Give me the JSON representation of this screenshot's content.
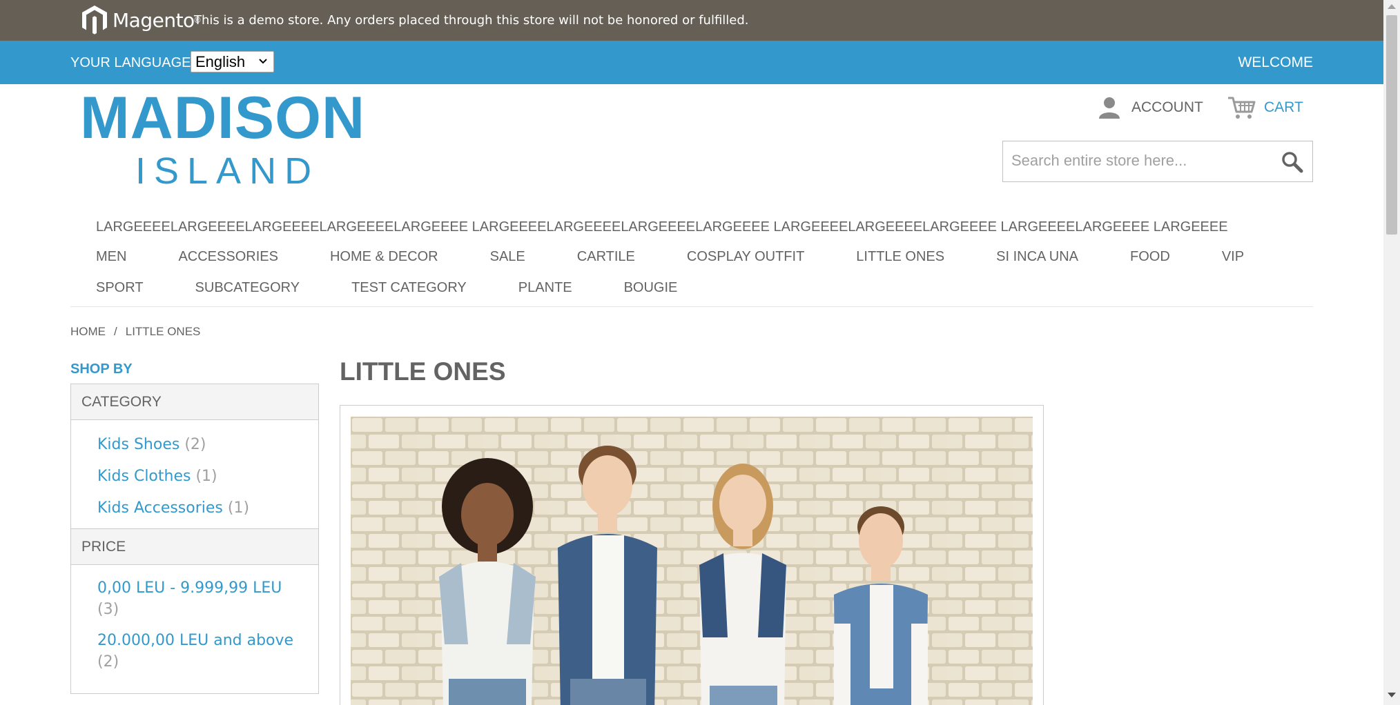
{
  "demo_notice": {
    "logo_text": "Magento",
    "text": "This is a demo store. Any orders placed through this store will not be honored or fulfilled."
  },
  "language": {
    "label": "YOUR LANGUAGE:",
    "selected": "English"
  },
  "welcome": "WELCOME",
  "brand": {
    "line1": "MADISON",
    "line2": "ISLAND",
    "color": "#3399cc"
  },
  "header": {
    "account": "ACCOUNT",
    "cart": "CART",
    "search_placeholder": "Search entire store here..."
  },
  "nav": {
    "long_item": "LARGEEEELARGEEEELARGEEEELARGEEEELARGEEEE LARGEEEELARGEEEELARGEEEELARGEEEE LARGEEEELARGEEEELARGEEEE LARGEEEELARGEEEE LARGEEEE",
    "row1": [
      "MEN",
      "ACCESSORIES",
      "HOME & DECOR",
      "SALE",
      "CARTILE",
      "COSPLAY OUTFIT",
      "LITTLE ONES",
      "SI INCA UNA",
      "FOOD",
      "VIP"
    ],
    "row2": [
      "SPORT",
      "SUBCATEGORY",
      "TEST CATEGORY",
      "PLANTE",
      "BOUGIE"
    ]
  },
  "breadcrumb": {
    "home": "HOME",
    "separator": "/",
    "current": "LITTLE ONES"
  },
  "sidebar": {
    "shop_by": "SHOP BY",
    "category": {
      "title": "CATEGORY",
      "items": [
        {
          "label": "Kids Shoes",
          "count": "(2)"
        },
        {
          "label": "Kids Clothes",
          "count": "(1)"
        },
        {
          "label": "Kids Accessories",
          "count": "(1)"
        }
      ]
    },
    "price": {
      "title": "PRICE",
      "items": [
        {
          "label": "0,00 LEU - 9.999,99 LEU",
          "count": "(3)"
        },
        {
          "label": "20.000,00 LEU and above",
          "count": "(2)"
        }
      ]
    }
  },
  "main": {
    "title": "LITTLE ONES"
  },
  "colors": {
    "demo_bar": "#655f56",
    "lang_bar": "#3399cc",
    "text": "#636363",
    "link": "#3399cc"
  }
}
